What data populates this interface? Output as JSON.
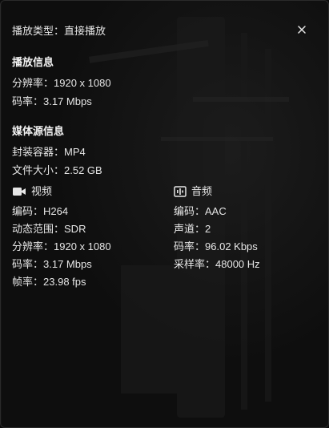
{
  "playback": {
    "type_label": "播放类型：",
    "type_value": "直接播放"
  },
  "close_icon": "close-icon",
  "playback_info": {
    "title": "播放信息",
    "resolution_label": "分辨率：",
    "resolution_value": "1920 x 1080",
    "bitrate_label": "码率：",
    "bitrate_value": "3.17 Mbps"
  },
  "media_source": {
    "title": "媒体源信息",
    "container_label": "封装容器：",
    "container_value": "MP4",
    "filesize_label": "文件大小：",
    "filesize_value": "2.52 GB"
  },
  "video": {
    "title": "视频",
    "icon": "video-camera-icon",
    "codec_label": "编码：",
    "codec_value": "H264",
    "dynamic_range_label": "动态范围：",
    "dynamic_range_value": "SDR",
    "resolution_label": "分辨率：",
    "resolution_value": "1920 x 1080",
    "bitrate_label": "码率：",
    "bitrate_value": "3.17 Mbps",
    "framerate_label": "帧率：",
    "framerate_value": "23.98 fps"
  },
  "audio": {
    "title": "音频",
    "icon": "audio-bars-icon",
    "codec_label": "编码：",
    "codec_value": "AAC",
    "channels_label": "声道：",
    "channels_value": "2",
    "bitrate_label": "码率：",
    "bitrate_value": "96.02 Kbps",
    "samplerate_label": "采样率：",
    "samplerate_value": "48000 Hz"
  },
  "colors": {
    "background": "#0e0e0e",
    "text": "#e6e6e6",
    "heading": "#f2f2f2"
  }
}
